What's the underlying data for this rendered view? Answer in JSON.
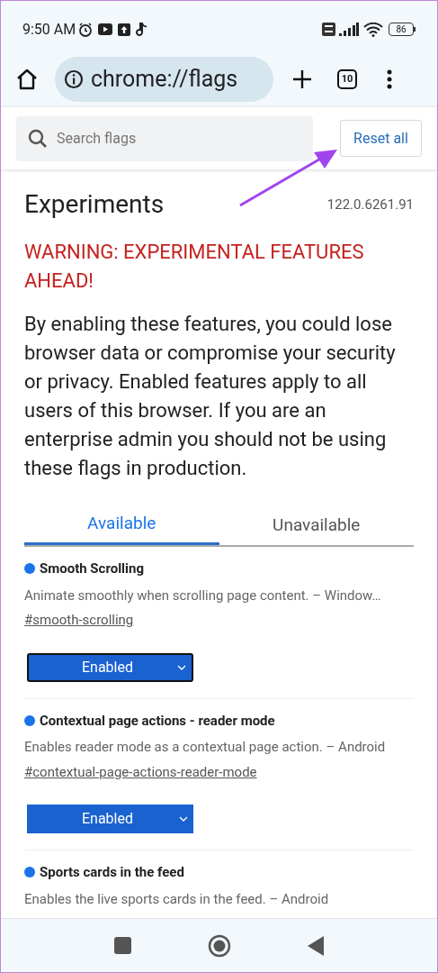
{
  "status_bar": {
    "time": "9:50 AM",
    "battery": "86"
  },
  "toolbar": {
    "url": "chrome://flags",
    "tab_count": "10"
  },
  "search": {
    "placeholder": "Search flags"
  },
  "reset_button": "Reset all",
  "title": "Experiments",
  "version": "122.0.6261.91",
  "warning": "WARNING: EXPERIMENTAL FEATURES AHEAD!",
  "intro": "By enabling these features, you could lose browser data or compromise your security or privacy. Enabled features apply to all users of this browser. If you are an enterprise admin you should not be using these flags in production.",
  "tabs": [
    {
      "label": "Available",
      "selected": true
    },
    {
      "label": "Unavailable",
      "selected": false
    }
  ],
  "flags": [
    {
      "name": "Smooth Scrolling",
      "description": "Animate smoothly when scrolling page content. – Window…",
      "link": "#smooth-scrolling",
      "value": "Enabled",
      "focused": true
    },
    {
      "name": "Contextual page actions - reader mode",
      "description": "Enables reader mode as a contextual page action. – Android",
      "link": "#contextual-page-actions-reader-mode",
      "value": "Enabled",
      "focused": false
    },
    {
      "name": "Sports cards in the feed",
      "description": "Enables the live sports cards in the feed. – Android"
    }
  ]
}
